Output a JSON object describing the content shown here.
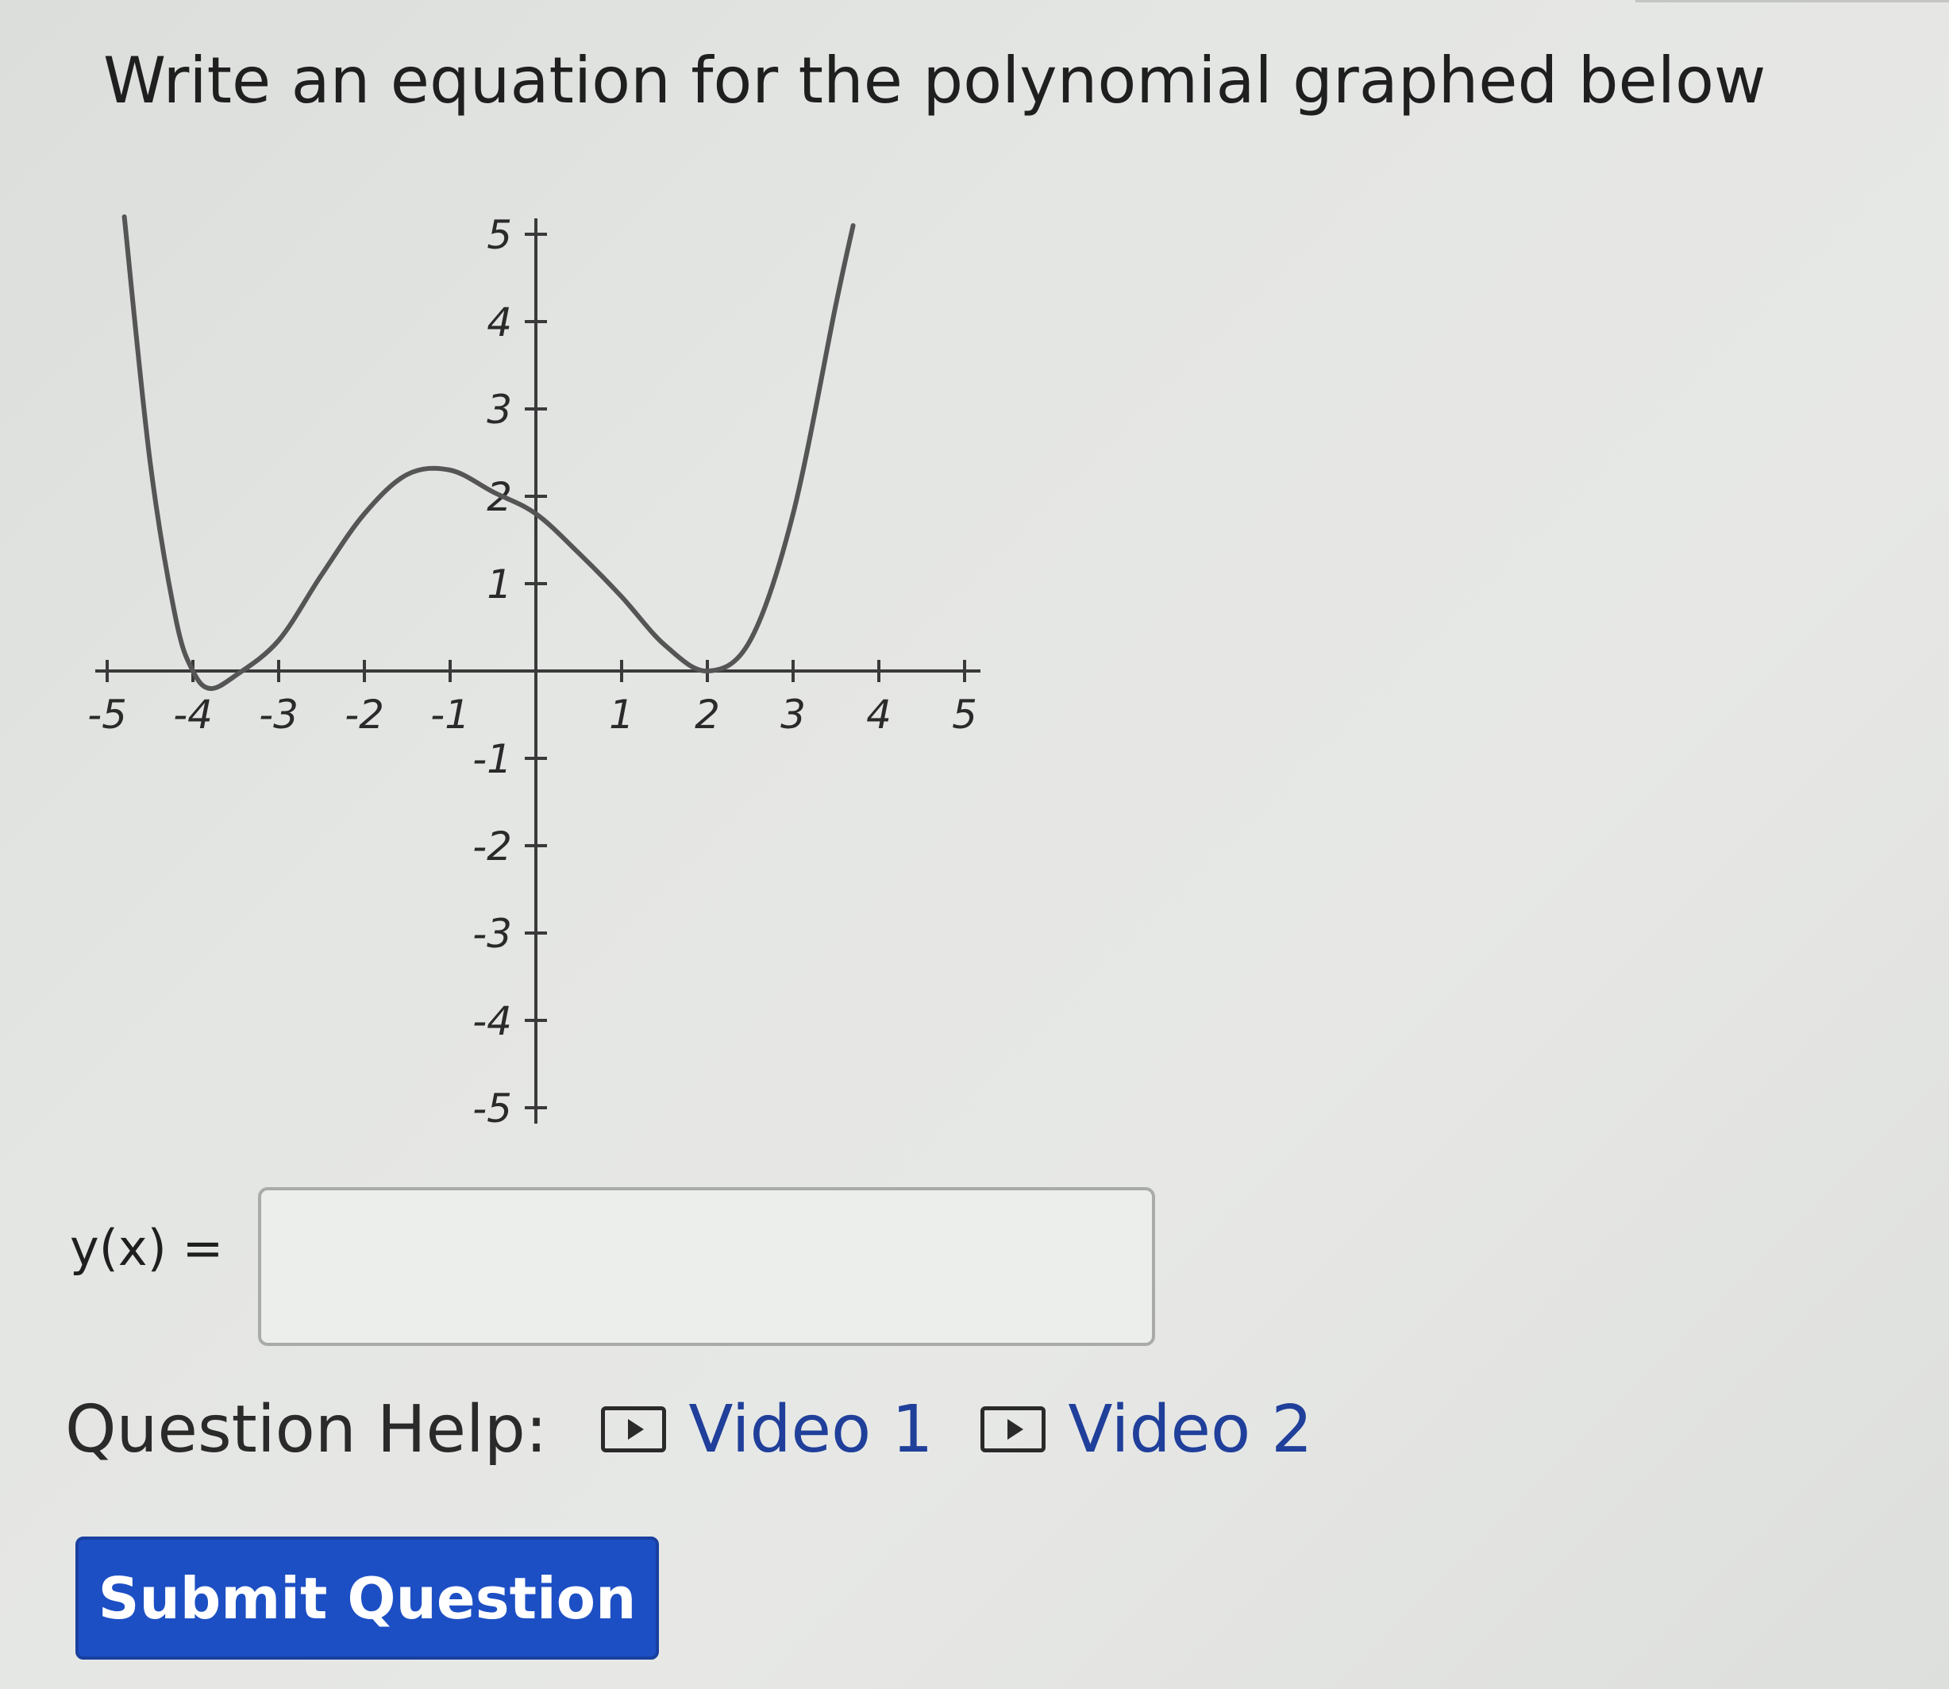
{
  "question": {
    "title": "Write an equation for the polynomial graphed below"
  },
  "chart_data": {
    "type": "line",
    "title": "",
    "xlabel": "",
    "ylabel": "",
    "xlim": [
      -5,
      5
    ],
    "ylim": [
      -5,
      5
    ],
    "x_ticks": [
      -5,
      -4,
      -3,
      -2,
      -1,
      1,
      2,
      3,
      4,
      5
    ],
    "y_ticks": [
      -5,
      -4,
      -3,
      -2,
      -1,
      1,
      2,
      3,
      4,
      5
    ],
    "x_tick_labels": [
      "-5",
      "-4",
      "-3",
      "-2",
      "-1",
      "1",
      "2",
      "3",
      "4",
      "5"
    ],
    "y_tick_labels": [
      "-5",
      "-4",
      "-3",
      "-2",
      "-1",
      "1",
      "2",
      "3",
      "4",
      "5"
    ],
    "grid": false,
    "series": [
      {
        "x": [
          -4.8,
          -4.5,
          -4.2,
          -4.0,
          -3.8,
          -3.5,
          -3.0,
          -2.5,
          -2.0,
          -1.5,
          -1.0,
          -0.5,
          0.0,
          0.5,
          1.0,
          1.5,
          2.0,
          2.5,
          3.0,
          3.5,
          3.7
        ],
        "y": [
          5.2,
          2.4,
          0.6,
          0.0,
          -0.2,
          -0.05,
          0.35,
          1.1,
          1.8,
          2.25,
          2.3,
          2.05,
          1.8,
          1.35,
          0.85,
          0.3,
          0.0,
          0.35,
          1.8,
          4.2,
          5.1
        ],
        "color": "#555555"
      }
    ]
  },
  "answer": {
    "label": "y(x) =",
    "value": "",
    "placeholder": ""
  },
  "help": {
    "label": "Question Help:",
    "videos": [
      {
        "label": "Video 1",
        "icon": "play-icon"
      },
      {
        "label": "Video 2",
        "icon": "play-icon"
      }
    ]
  },
  "magnify_icon": "magnifier-icon",
  "submit": {
    "label": "Submit Question",
    "color": "#1d4fc4"
  }
}
